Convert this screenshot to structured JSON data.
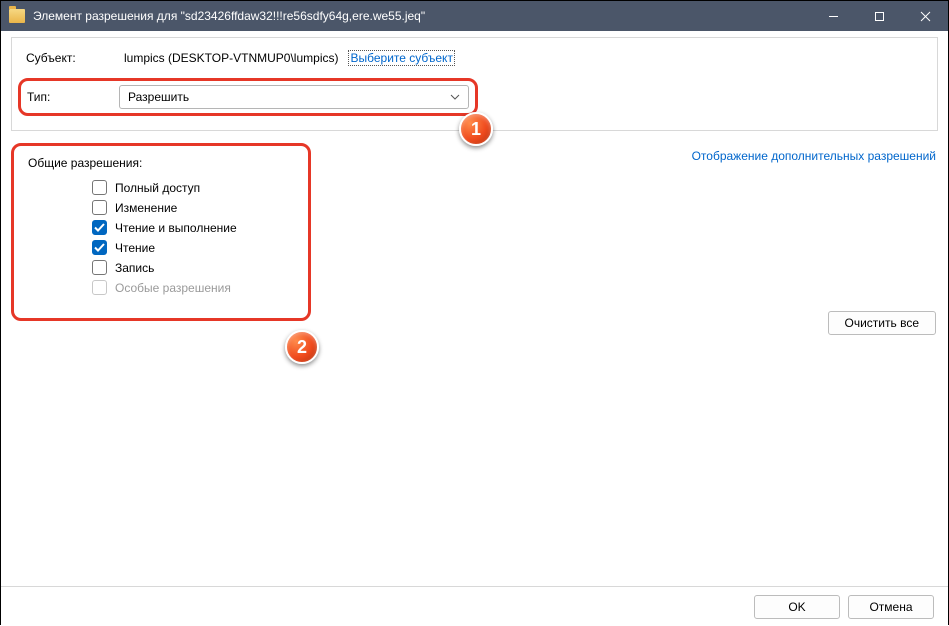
{
  "titlebar": {
    "title": "Элемент разрешения для \"sd23426ffdaw32!!!re56sdfy64g,ere.we55.jeq\""
  },
  "subject": {
    "label": "Субъект:",
    "value": "lumpics (DESKTOP-VTNMUP0\\lumpics)",
    "select_link": "Выберите субъект"
  },
  "type": {
    "label": "Тип:",
    "value": "Разрешить"
  },
  "permissions": {
    "title": "Общие разрешения:",
    "items": [
      {
        "label": "Полный доступ",
        "checked": false,
        "disabled": false
      },
      {
        "label": "Изменение",
        "checked": false,
        "disabled": false
      },
      {
        "label": "Чтение и выполнение",
        "checked": true,
        "disabled": false
      },
      {
        "label": "Чтение",
        "checked": true,
        "disabled": false
      },
      {
        "label": "Запись",
        "checked": false,
        "disabled": false
      },
      {
        "label": "Особые разрешения",
        "checked": false,
        "disabled": true
      }
    ]
  },
  "links": {
    "advanced": "Отображение дополнительных разрешений"
  },
  "buttons": {
    "clear_all": "Очистить все",
    "ok": "OK",
    "cancel": "Отмена"
  },
  "badges": {
    "b1": "1",
    "b2": "2"
  }
}
